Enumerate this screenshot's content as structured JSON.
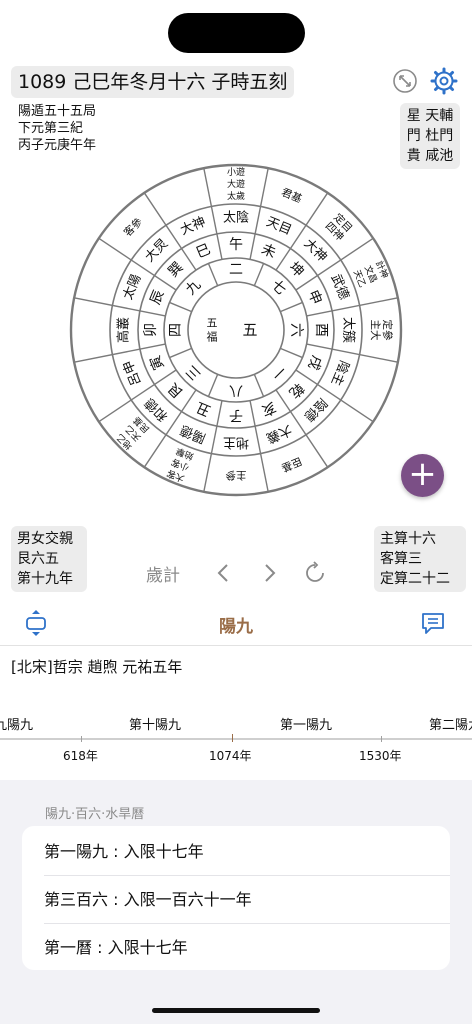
{
  "header": {
    "title": "1089 己巳年冬月十六 子時五刻"
  },
  "info_top_left": [
    "陽遁五十五局",
    "下元第三紀",
    "丙子元庚午年"
  ],
  "info_top_right": [
    "星 天輔",
    "門 杜門",
    "貴 咸池"
  ],
  "info_bottom_left": [
    "男女交親",
    "艮六五",
    "第十九年"
  ],
  "info_bottom_right": [
    "主算十六",
    "客算三",
    "定算二十二"
  ],
  "wheel": {
    "center": "五",
    "center_small": "五福",
    "ring1": [
      "二",
      "七",
      "六",
      "一",
      "八",
      "三",
      "四",
      "九"
    ],
    "ring2": [
      "午",
      "未",
      "坤",
      "申",
      "酉",
      "戌",
      "乾",
      "亥",
      "子",
      "丑",
      "艮",
      "寅",
      "卯",
      "辰",
      "巽",
      "巳"
    ],
    "ring3": [
      "太陰",
      "天目",
      "大神",
      "武德",
      "太簇",
      "陰主",
      "陰德",
      "大義",
      "地主",
      "陽德",
      "和德",
      "呂申",
      "高叢",
      "太陽",
      "大炅",
      "大神"
    ],
    "outer_entries": [
      {
        "lines": [
          "太歲",
          "大遊",
          "小遊"
        ]
      },
      {
        "lines": [
          "君基"
        ]
      },
      {
        "lines": [
          "四神",
          "定目"
        ]
      },
      {
        "lines": [
          "天乙",
          "文昌",
          "計神"
        ]
      },
      {
        "lines": [
          "主大",
          "定參"
        ]
      },
      {
        "lines": []
      },
      {
        "lines": []
      },
      {
        "lines": [
          "臣基"
        ]
      },
      {
        "lines": [
          "主參"
        ]
      },
      {
        "lines": [
          "始擊",
          "小客",
          "大客"
        ]
      },
      {
        "lines": [
          "民基",
          "天乙",
          "地乙"
        ]
      },
      {
        "lines": []
      },
      {
        "lines": []
      },
      {
        "lines": []
      },
      {
        "lines": [
          "客參"
        ]
      },
      {
        "lines": []
      }
    ]
  },
  "nav": {
    "label": "歲計",
    "prev_icon": "chevron-left-icon",
    "next_icon": "chevron-right-icon",
    "reset_icon": "refresh-icon"
  },
  "tab": {
    "title": "陽九"
  },
  "era": "[北宋]哲宗 趙煦 元祐五年",
  "timeline": {
    "labels": [
      "九陽九",
      "第十陽九",
      "第一陽九",
      "第二陽九"
    ],
    "years": [
      "618年",
      "1074年",
      "1530年"
    ]
  },
  "details": {
    "section_title": "陽九·百六·水旱曆",
    "rows": [
      "第一陽九 : 入限十七年",
      "第三百六 : 入限一百六十一年",
      "第一曆 : 入限十七年"
    ]
  },
  "colors": {
    "accent": "#7b4f86",
    "brown": "#9a6d48",
    "blue": "#2f72c9"
  }
}
